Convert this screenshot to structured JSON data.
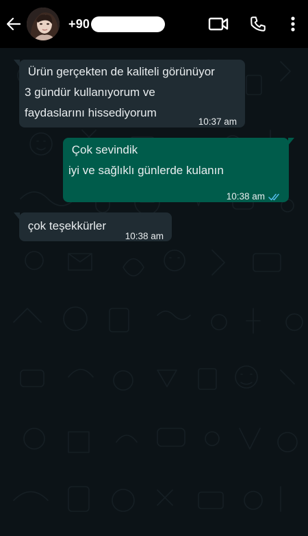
{
  "header": {
    "contact_name": "+90",
    "icons": [
      "back-arrow-icon",
      "video-call-icon",
      "voice-call-icon",
      "more-vert-icon"
    ]
  },
  "messages": [
    {
      "direction": "incoming",
      "lines": [
        " Ürün gerçekten de kaliteli görünüyor",
        "3 gündür kullanıyorum ve",
        "faydaslarını hissediyorum"
      ],
      "time": "10:37 am"
    },
    {
      "direction": "outgoing",
      "lines": [
        " Çok sevindik",
        "iyi ve sağlıklı günlerde kulanın"
      ],
      "time": "10:38 am",
      "status": "read"
    },
    {
      "direction": "incoming",
      "lines": [
        " çok teşekkürler"
      ],
      "time": "10:38 am"
    }
  ],
  "colors": {
    "header_bg": "#000000",
    "chat_bg": "#0c1317",
    "incoming_bubble": "#202c33",
    "outgoing_bubble": "#005c4b",
    "text": "#e9edef",
    "read_ticks": "#53bdeb"
  }
}
